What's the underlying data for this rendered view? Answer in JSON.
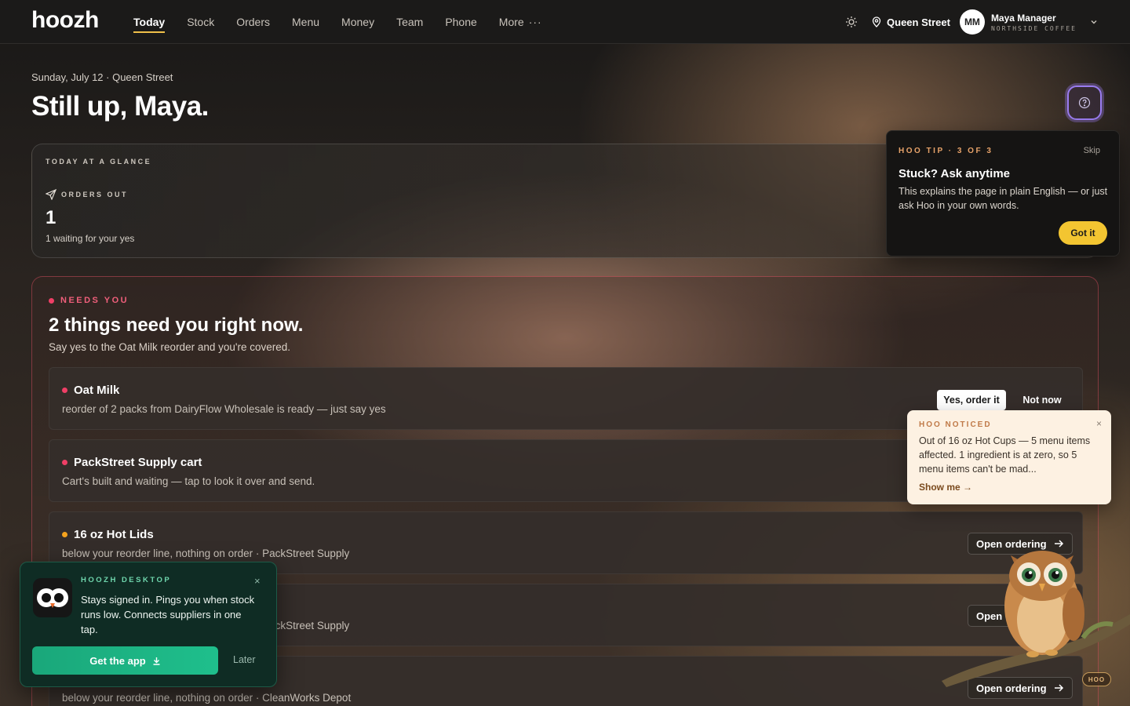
{
  "app": {
    "logo": "hoozh"
  },
  "nav": {
    "links": [
      "Today",
      "Stock",
      "Orders",
      "Menu",
      "Money",
      "Team",
      "Phone",
      "More"
    ],
    "more_dots": "···",
    "location": "Queen Street",
    "avatar_initials": "MM",
    "user_name": "Maya Manager",
    "user_org": "NORTHSIDE COFFEE"
  },
  "header": {
    "date_line": "Sunday, July 12 · Queen Street",
    "greeting": "Still up, Maya."
  },
  "glance": {
    "kicker": "TODAY AT A GLANCE",
    "orders_label": "ORDERS OUT",
    "orders_value": "1",
    "orders_sub": "1 waiting for your yes"
  },
  "tip": {
    "kicker": "HOO TIP · 3 OF 3",
    "skip": "Skip",
    "title": "Stuck? Ask anytime",
    "body": "This explains the page in plain English — or just ask Hoo in your own words.",
    "button": "Got it"
  },
  "needs": {
    "kicker": "NEEDS YOU",
    "title": "2 things need you right now.",
    "subtitle": "Say yes to the Oat Milk reorder and you're covered.",
    "items": [
      {
        "title": "Oat Milk",
        "desc": "reorder of 2 packs from DairyFlow Wholesale is ready — just say yes",
        "yes": "Yes, order it",
        "not": "Not now"
      },
      {
        "title": "PackStreet Supply cart",
        "desc": "Cart's built and waiting — tap to look it over and send."
      },
      {
        "title": "16 oz Hot Lids",
        "desc": "below your reorder line, nothing on order · PackStreet Supply",
        "open": "Open ordering"
      },
      {
        "title": "",
        "desc": "below your reorder line, nothing on order · PackStreet Supply",
        "open": "Open ordering"
      },
      {
        "title": "",
        "desc": "below your reorder line, nothing on order · CleanWorks Depot",
        "open": "Open ordering"
      }
    ]
  },
  "noticed": {
    "kicker": "HOO NOTICED",
    "close": "×",
    "body": "Out of 16 oz Hot Cups — 5 menu items affected. 1 ingredient is at zero, so 5 menu items can't be mad...",
    "link": "Show me →"
  },
  "promo": {
    "kicker": "HOOZH DESKTOP",
    "close": "×",
    "body": "Stays signed in. Pings you when stock runs low. Connects suppliers in one tap.",
    "button": "Get the app",
    "later": "Later"
  },
  "owl": {
    "badge": "HOO"
  },
  "colors": {
    "accent_yellow": "#f3c531",
    "alert_red": "#ef3f66",
    "warn_amber": "#f4a31e",
    "promo_green": "#1aa77a"
  }
}
